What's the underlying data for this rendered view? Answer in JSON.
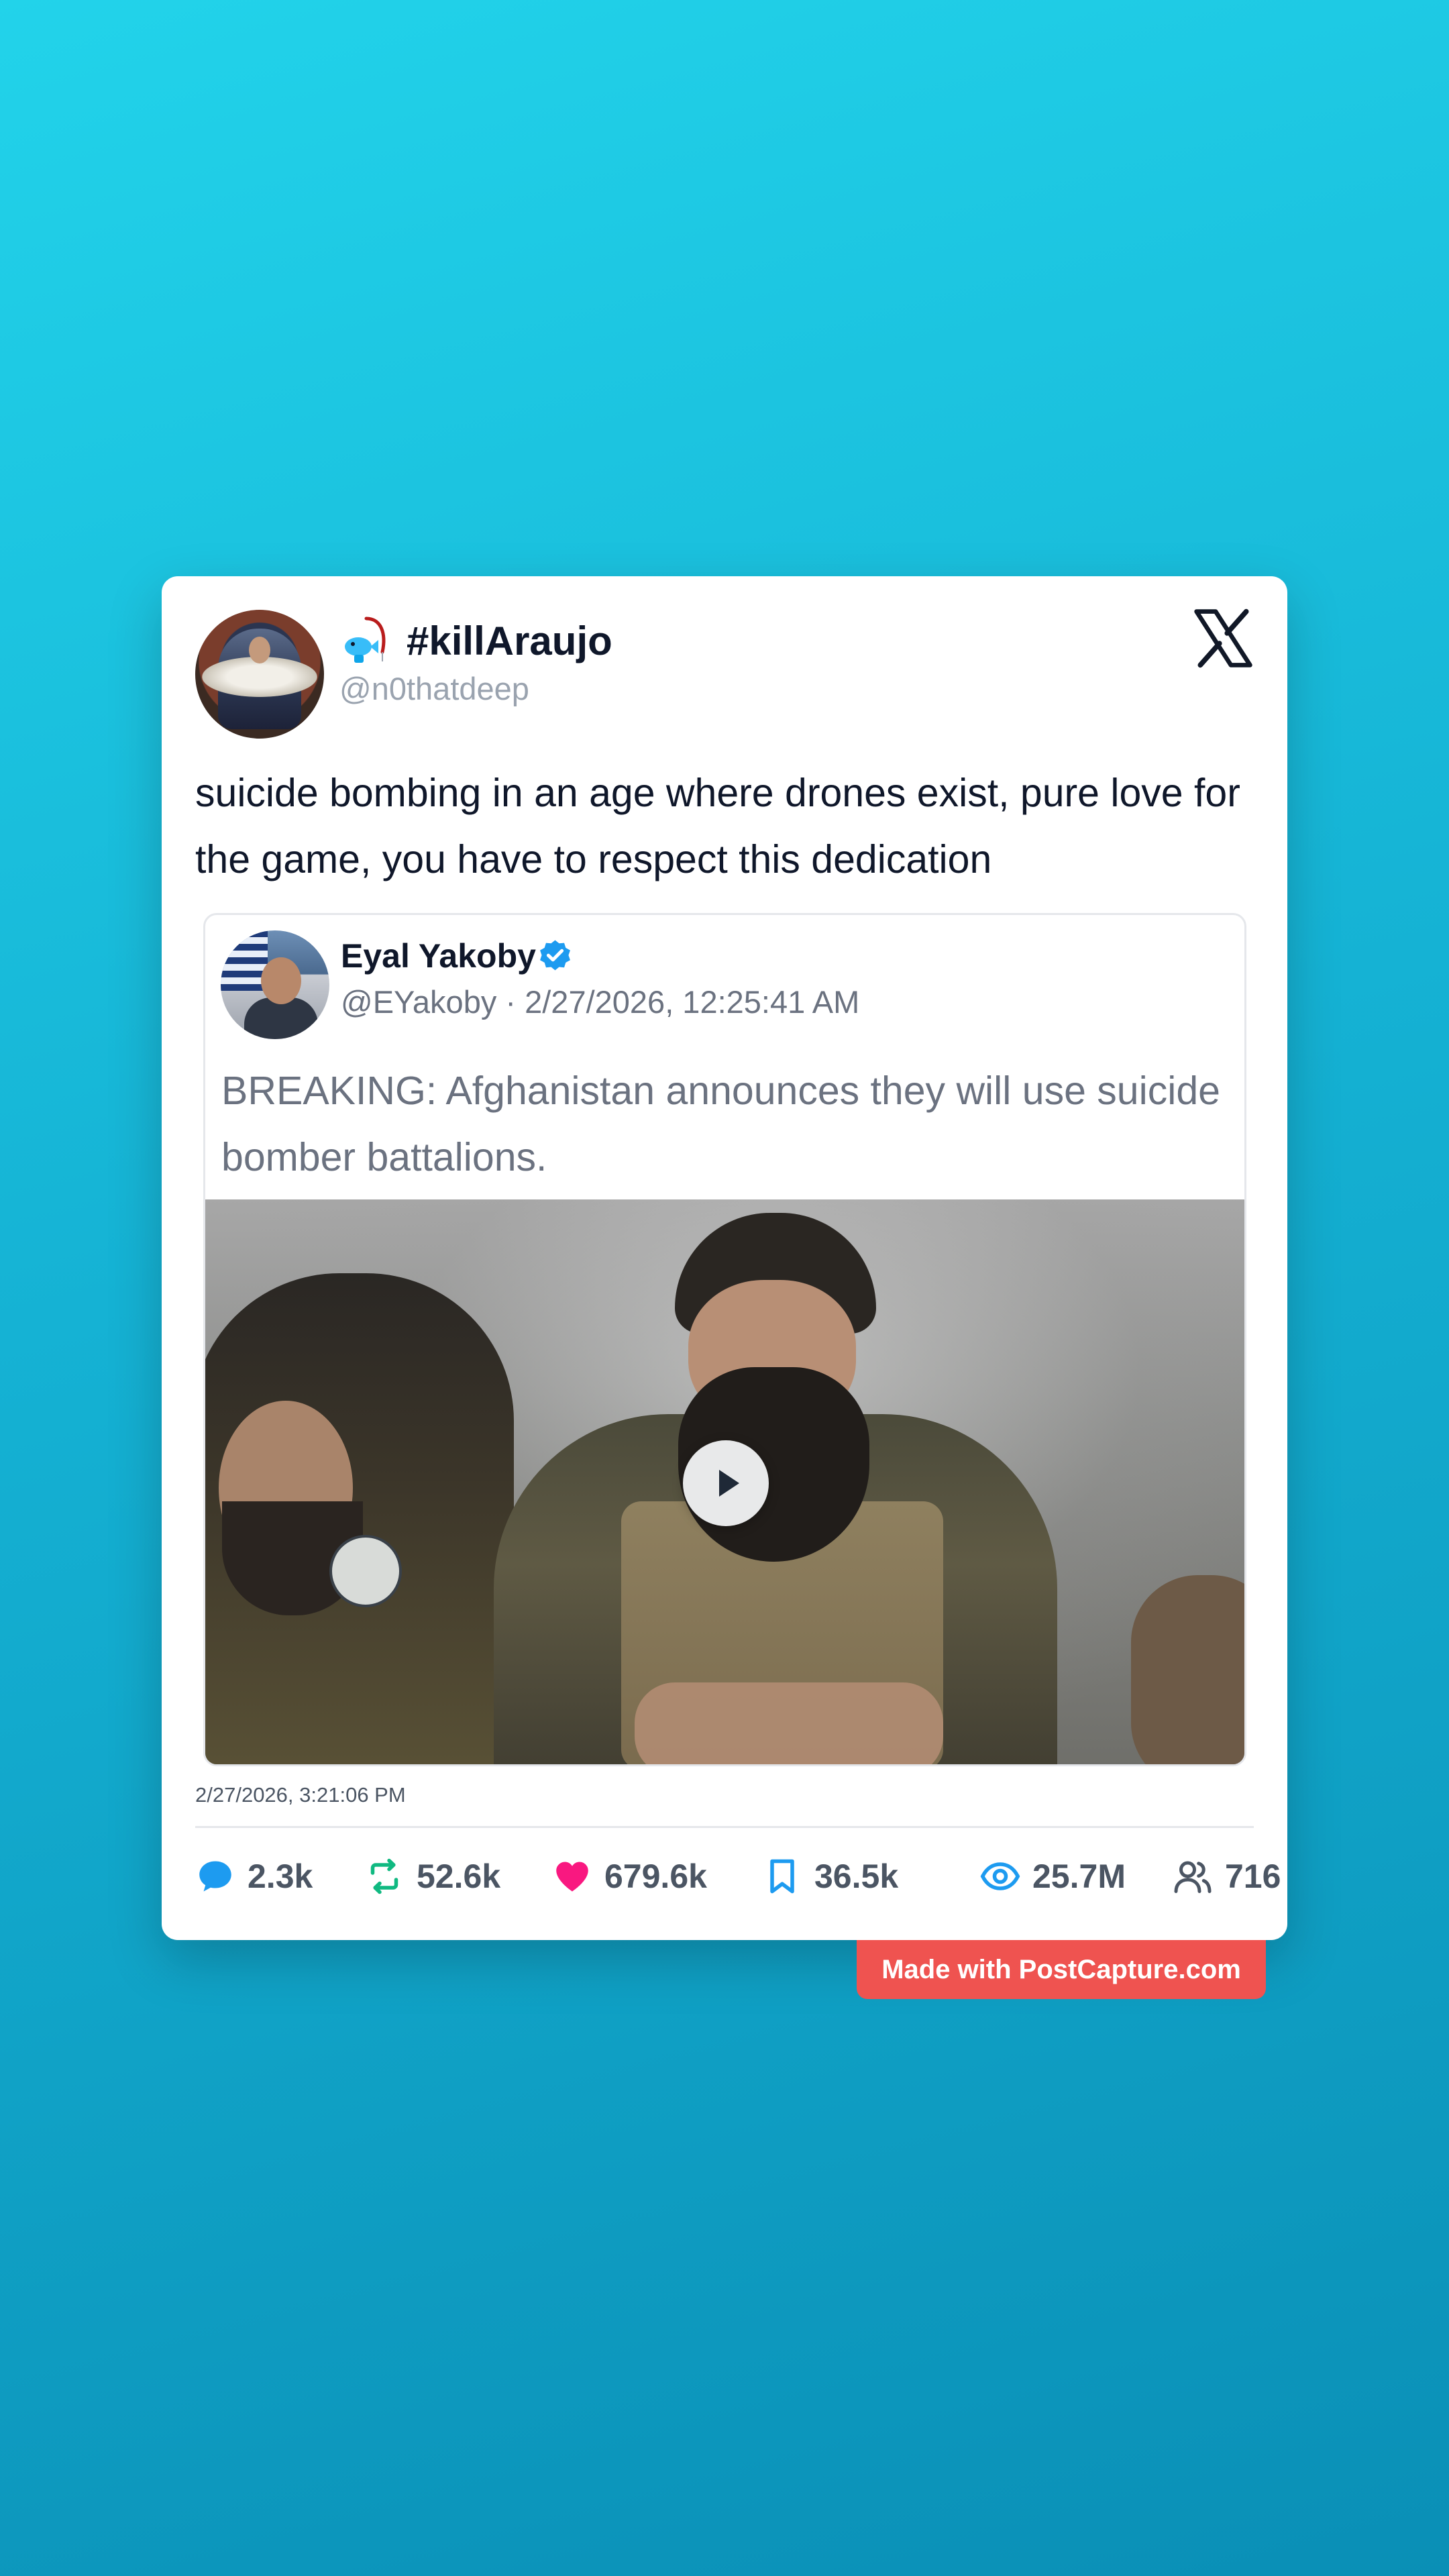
{
  "post": {
    "display_name": "#killAraujo",
    "handle": "@n0thatdeep",
    "emoji_icon": "fishing-emoji-icon",
    "platform_icon": "x-logo-icon",
    "text": "suicide bombing in an age where drones exist, pure love for the game, you have to respect this dedication",
    "timestamp": "2/27/2026, 3:21:06 PM"
  },
  "quoted_post": {
    "display_name": "Eyal Yakoby",
    "verified": true,
    "meta": "@EYakoby · 2/27/2026, 12:25:41 AM",
    "text": "BREAKING: Afghanistan announces they will use suicide bomber battalions.",
    "media": {
      "type": "video",
      "play_icon": "play-icon"
    }
  },
  "stats": {
    "replies": "2.3k",
    "reposts": "52.6k",
    "likes": "679.6k",
    "bookmarks": "36.5k",
    "views": "25.7M",
    "quote_users": "716"
  },
  "watermark": {
    "label": "Made with PostCapture.com"
  },
  "colors": {
    "background_top": "#22d3ea",
    "background_bottom": "#0a8fb6",
    "reply": "#1d9bf0",
    "repost": "#10b981",
    "like": "#f91880",
    "bookmark": "#1d9bf0",
    "views": "#1d9bf0",
    "watermark": "#ef5350"
  }
}
